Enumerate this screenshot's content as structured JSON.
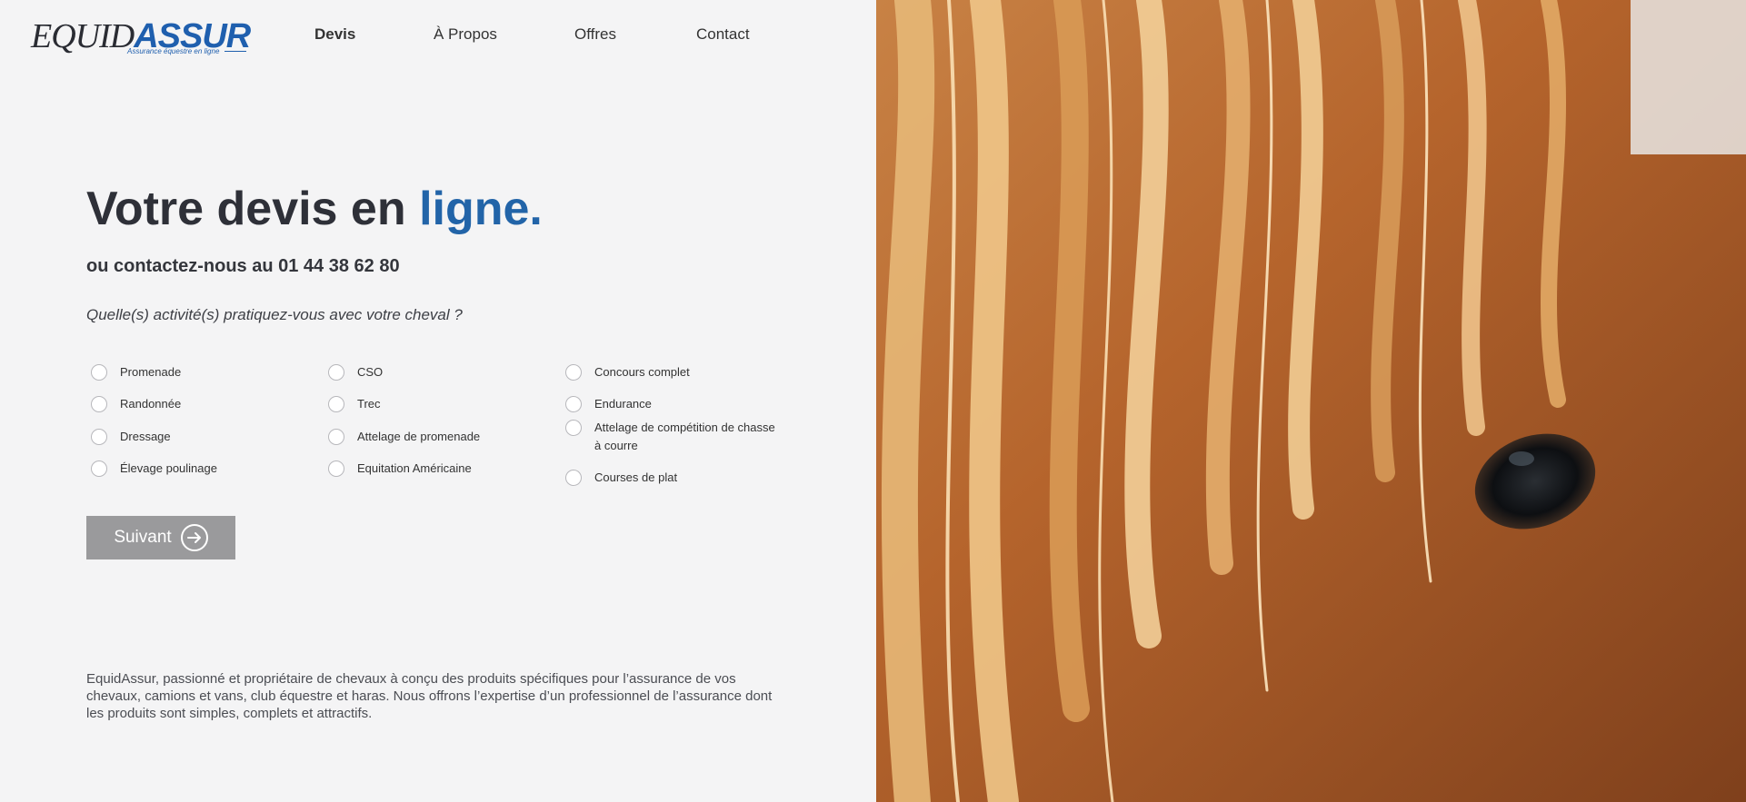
{
  "brand": {
    "logo_part1": "EQUID",
    "logo_part2": "ASSUR",
    "tagline": "Assurance équestre en ligne",
    "colors": {
      "primary": "#1f5fae",
      "dark": "#2e3038",
      "button": "#9a9a9c",
      "background": "#f4f4f5"
    }
  },
  "nav": {
    "items": [
      {
        "label": "Devis",
        "active": true
      },
      {
        "label": "À Propos",
        "active": false
      },
      {
        "label": "Offres",
        "active": false
      },
      {
        "label": "Contact",
        "active": false
      }
    ]
  },
  "hero": {
    "title_main": "Votre devis en ",
    "title_accent": "ligne.",
    "contact_line": "ou contactez-nous au 01 44 38 62 80",
    "question": "Quelle(s) activité(s) pratiquez-vous avec votre cheval ?"
  },
  "activities": {
    "col1": [
      "Promenade",
      "Randonnée",
      "Dressage",
      "Élevage poulinage"
    ],
    "col2": [
      "CSO",
      "Trec",
      "Attelage de promenade",
      "Equitation Américaine"
    ],
    "col3_line1": "Concours complet",
    "col3_line2": "Endurance",
    "col3_line3a": "Attelage de compétition de chasse",
    "col3_line3b": "à courre",
    "col3_line4": "Courses de plat"
  },
  "next_button": {
    "label": "Suivant",
    "icon": "arrow-right-circle-icon"
  },
  "about": "EquidAssur, passionné et propriétaire de chevaux à conçu des produits spécifiques pour l’assurance de vos chevaux, camions et vans, club équestre et haras. Nous offrons l’expertise d’un professionnel de l’assurance dont les produits sont simples, complets et attractifs.",
  "hero_image": {
    "subject": "horse-close-up"
  }
}
